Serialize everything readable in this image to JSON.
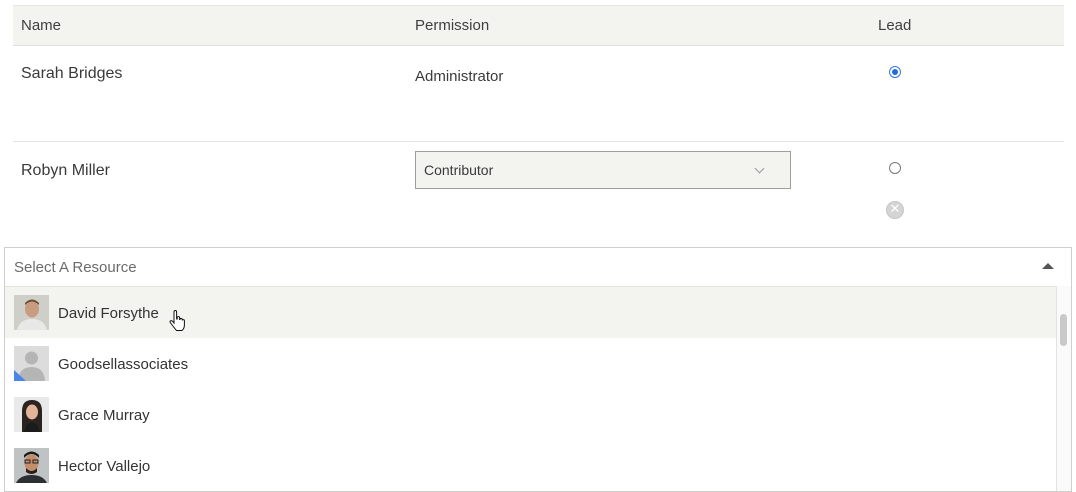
{
  "table": {
    "headers": {
      "name": "Name",
      "permission": "Permission",
      "lead": "Lead"
    },
    "rows": [
      {
        "name": "Sarah Bridges",
        "permission": "Administrator",
        "lead": true
      },
      {
        "name": "Robyn Miller",
        "permission": "Contributor",
        "lead": false
      }
    ]
  },
  "resource_picker": {
    "placeholder": "Select A Resource",
    "items": [
      {
        "label": "David Forsythe",
        "avatar": "photo-man"
      },
      {
        "label": "Goodsellassociates",
        "avatar": "default-person"
      },
      {
        "label": "Grace Murray",
        "avatar": "photo-woman"
      },
      {
        "label": "Hector Vallejo",
        "avatar": "photo-man-glasses"
      }
    ]
  },
  "colors": {
    "header_bg": "#f3f3f0",
    "radio_selected": "#1f6fd8",
    "hover_row_bg": "#f3f3f0"
  }
}
